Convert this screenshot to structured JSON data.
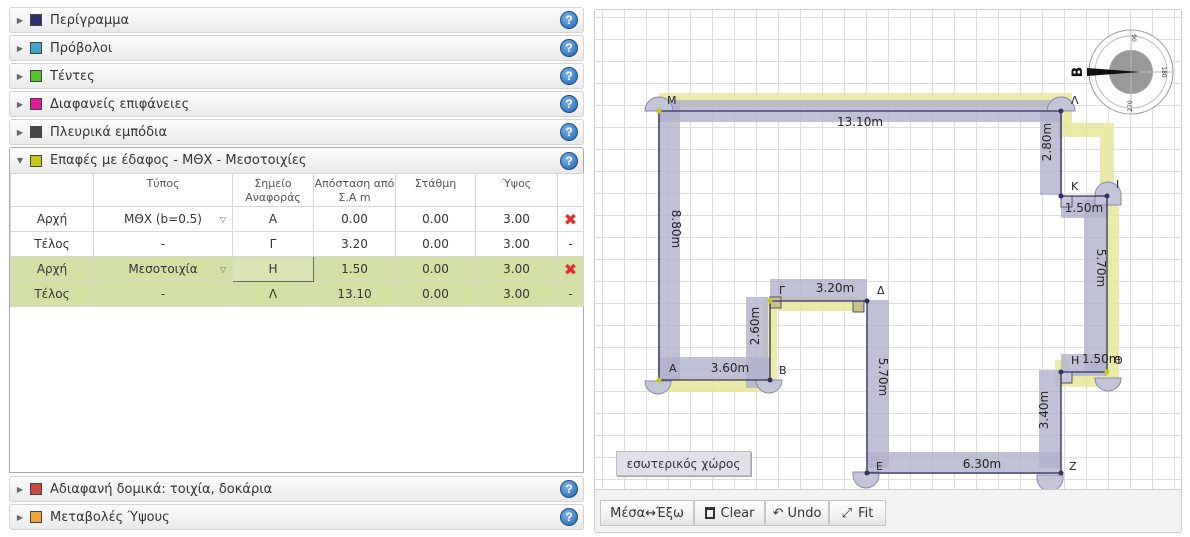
{
  "accordion": {
    "sections": [
      {
        "label": "Περίγραμμα",
        "color": "#2e2f6e"
      },
      {
        "label": "Πρόβολοι",
        "color": "#3fa8c8"
      },
      {
        "label": "Τέντες",
        "color": "#55c22a"
      },
      {
        "label": "Διαφανείς επιφάνειες",
        "color": "#e0199b"
      },
      {
        "label": "Πλευρικά εμπόδια",
        "color": "#444444"
      },
      {
        "label": "Επαφές με έδαφος - ΜΘΧ - Μεσοτοιχίες",
        "color": "#c8c81a"
      },
      {
        "label": "Αδιαφανή δομικά: τοιχία, δοκάρια",
        "color": "#c94a3c"
      },
      {
        "label": "Μεταβολές Ύψους",
        "color": "#f5a23a"
      }
    ],
    "help_glyph": "?",
    "expand_glyph": "▶",
    "collapse_glyph": "▼"
  },
  "table": {
    "headers": [
      "",
      "Τύπος",
      "Σημείο Αναφοράς",
      "Απόσταση από Σ.Α m",
      "Στάθμη",
      "Ύψος",
      ""
    ],
    "rows": [
      {
        "c0": "Αρχή",
        "c1": "ΜΘΧ (b=0.5)",
        "c2": "Α",
        "c3": "0.00",
        "c4": "0.00",
        "c5": "3.00",
        "c6": "✖"
      },
      {
        "c0": "Τέλος",
        "c1": "-",
        "c2": "Γ",
        "c3": "3.20",
        "c4": "0.00",
        "c5": "3.00",
        "c6": "-"
      },
      {
        "c0": "Αρχή",
        "c1": "Μεσοτοιχία",
        "c2": "Η",
        "c3": "1.50",
        "c4": "0.00",
        "c5": "3.00",
        "c6": "✖"
      },
      {
        "c0": "Τέλος",
        "c1": "-",
        "c2": "Λ",
        "c3": "13.10",
        "c4": "0.00",
        "c5": "3.00",
        "c6": "-"
      }
    ]
  },
  "drawing": {
    "dimensions": [
      "13.10m",
      "2.80m",
      "1.50m",
      "5.70m",
      "1.50m",
      "3.40m",
      "6.30m",
      "5.70m",
      "3.20m",
      "2.60m",
      "3.60m",
      "8.80m"
    ],
    "points": [
      "Α",
      "Β",
      "Γ",
      "Δ",
      "Ε",
      "Ζ",
      "Η",
      "Θ",
      "Ι",
      "Κ",
      "Λ",
      "Μ"
    ],
    "compass": {
      "north": "Β",
      "deg90": "90",
      "deg180": "180",
      "deg270": "270"
    },
    "area_label": "εσωτερικός χώρος",
    "colors": {
      "wall": "#b8b8d0",
      "contact": "#e8e89a",
      "outline": "#202050"
    }
  },
  "toolbar": {
    "inout": "Μέσα↔Έξω",
    "clear": "Clear",
    "undo": "Undo",
    "fit": "Fit"
  }
}
